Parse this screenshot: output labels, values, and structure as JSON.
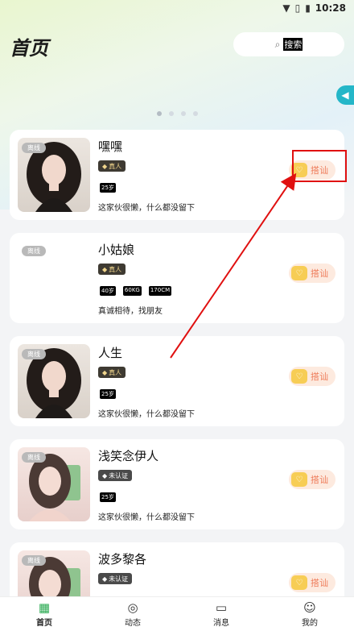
{
  "status_bar": {
    "time": "10:28",
    "icons": [
      "wifi-icon",
      "sim-icon",
      "battery-icon"
    ]
  },
  "header": {
    "title": "首页",
    "search_placeholder": "搜索"
  },
  "carousel": {
    "dots": 4,
    "active_index": 0
  },
  "online_label": "离线",
  "greet_label": "搭讪",
  "cards": [
    {
      "name": "嘿嘿",
      "verify": "真人",
      "verified": true,
      "tags": [
        "25岁"
      ],
      "bio": "这家伙很懒，什么都没留下",
      "avatar": "dark-hair-girl"
    },
    {
      "name": "小姑娘",
      "verify": "真人",
      "verified": true,
      "tags": [
        "40岁",
        "60KG",
        "170CM"
      ],
      "bio": "真诚相待，找朋友",
      "avatar": "none"
    },
    {
      "name": "人生",
      "verify": "真人",
      "verified": true,
      "tags": [
        "25岁"
      ],
      "bio": "这家伙很懒，什么都没留下",
      "avatar": "dark-hair-girl"
    },
    {
      "name": "浅笑念伊人",
      "verify": "未认证",
      "verified": false,
      "tags": [
        "25岁"
      ],
      "bio": "这家伙很懒，什么都没留下",
      "avatar": "phone-selfie-girl"
    },
    {
      "name": "波多黎各",
      "verify": "未认证",
      "verified": false,
      "tags": [],
      "bio": "",
      "avatar": "phone-selfie-girl"
    }
  ],
  "bottom_nav": [
    {
      "label": "首页",
      "icon": "home-icon",
      "active": true
    },
    {
      "label": "动态",
      "icon": "compass-icon",
      "active": false
    },
    {
      "label": "消息",
      "icon": "message-icon",
      "active": false
    },
    {
      "label": "我的",
      "icon": "profile-icon",
      "active": false
    }
  ],
  "colors": {
    "accent": "#26a84e",
    "greet_text": "#ee7c5a",
    "greet_bg": "#fdeadf",
    "annotation": "#e01010"
  }
}
